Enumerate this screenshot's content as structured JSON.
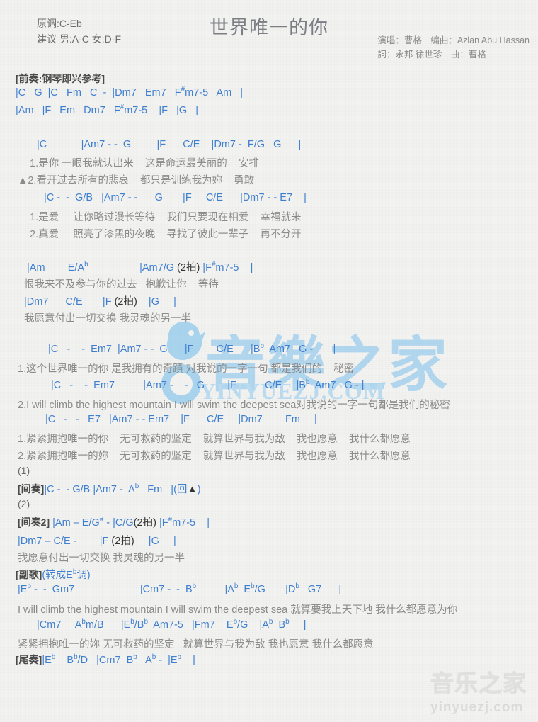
{
  "header": {
    "original_key": "原调:C-Eb",
    "suggested_key": "建议 男:A-C 女:D-F",
    "title": "世界唯一的你",
    "credit_line1": "演唱：曹格　编曲：Azlan Abu Hassan",
    "credit_line2": "詞：永邦 徐世珍　曲：曹格"
  },
  "sections": {
    "intro_label": "[前奏:钢琴即兴参考]",
    "interlude_label": "[间奏]",
    "interlude2_label": "[间奏2]",
    "chorus_label": "[副歌]",
    "outro_label": "[尾奏]"
  },
  "lines": {
    "intro_c1": "|C   G  |C   Fm   C  -  |Dm7   Em7   F#m7-5   Am   |",
    "intro_c2": "|Am   |F   Em   Dm7   F#m7-5   |F   |G   |",
    "v1_c1": "|C            |Am7 - -  G         |F      C/E    |Dm7 -  F/G   G      |",
    "v1_l1": "1.是你 一眼我就认出来    这是命运最美丽的    安排",
    "v1_l2": "▲2.看开过去所有的悲哀    都只是训练我为妳    勇敢",
    "v2_c1": "|C -  -  G/B   |Am7 - -      G       |F     C/E      |Dm7 - - E7    |",
    "v2_l1": "1.是爱     让你略过漫长等待    我们只要现在相爱    幸福就来",
    "v2_l2": "2.真爱     照亮了漆黑的夜晚    寻找了彼此一辈子    再不分开",
    "pre_c1": "|Am         E/A♭                  |Am7/G (2拍) |F#m7-5    |",
    "pre_l1": "恨我来不及参与你的过去   抱歉让你    等待",
    "pre_c2": "|Dm7      C/E       |F (2拍)     |G     |",
    "pre_l2": "我愿意付出一切交换 我灵魂的另一半",
    "ch_c1": "|C   -    -  Em7  |Am7 - -  G      |F        C/E      |B♭  Am7   G -       |",
    "ch_l1": "1.这个世界唯一的你 是我拥有的奇蹟 对我说的一字一句 都是我们的    秘密",
    "ch_c2": "|C   -    -  Em7          |Am7 -    -   G        |F          C/E     |B♭  Am7   G - |",
    "ch_l2": "2.I will climb the highest mountain I will swim the deepest sea对我说的一字一句都是我们的秘密",
    "ch_c3": "|C   -   -   E7   |Am7 - - Em7    |F      C/E     |Dm7        Fm     |",
    "ch_l3": "1.紧紧拥抱唯一的你    无可救药的坚定    就算世界与我为敌    我也愿意    我什么都愿意",
    "ch_l4": "2.紧紧拥抱唯一的妳    无可救药的坚定    就算世界与我为敌    我也愿意    我什么都愿意",
    "ending1_num": "(1)",
    "interlude_c": "|C -  - G/B |Am7 -  A♭   Fm   |(回▲)",
    "ending2_num": "(2)",
    "interlude2_c": "|Am – E/G# - |C/G(2拍) |F#m7-5    |",
    "interlude2_c2": "|Dm7 – C/E -        |F (2拍)     |G     |",
    "interlude2_l": "我愿意付出一切交换 我灵魂的另一半",
    "chorus_key_note": "(转成E♭调)",
    "mod_c1": "|E♭ -  -  Gm7                       |Cm7 -  -  B♭          |A♭  E♭/G       |D♭   G7      |",
    "mod_l1": "I will climb the highest mountain I will swim the deepest sea 就算要我上天下地 我什么都愿意为你",
    "mod_c2": "|Cm7     A♭m/B      |E♭/B♭  Am7-5   |Fm7    E♭/G    |A♭  B♭     |",
    "mod_l2": "紧紧拥抱唯一的妳 无可救药的坚定   就算世界与我为敌 我也愿意 我什么都愿意",
    "outro_c": "|E♭    B♭/D   |Cm7  B♭   A♭ -  |E♭    |"
  },
  "watermarks": {
    "center_cjk": "音樂之家",
    "center_latin": "YINYUEZJ.COM",
    "bottom_cjk": "音乐之家",
    "bottom_latin": "yinyuezj.com"
  },
  "colors": {
    "chord": "#3f7fd0",
    "lyric": "#8b8b8b",
    "title": "#7b7e83",
    "background": "#f2f2f0",
    "watermark_blue": "#7cc0ee"
  }
}
